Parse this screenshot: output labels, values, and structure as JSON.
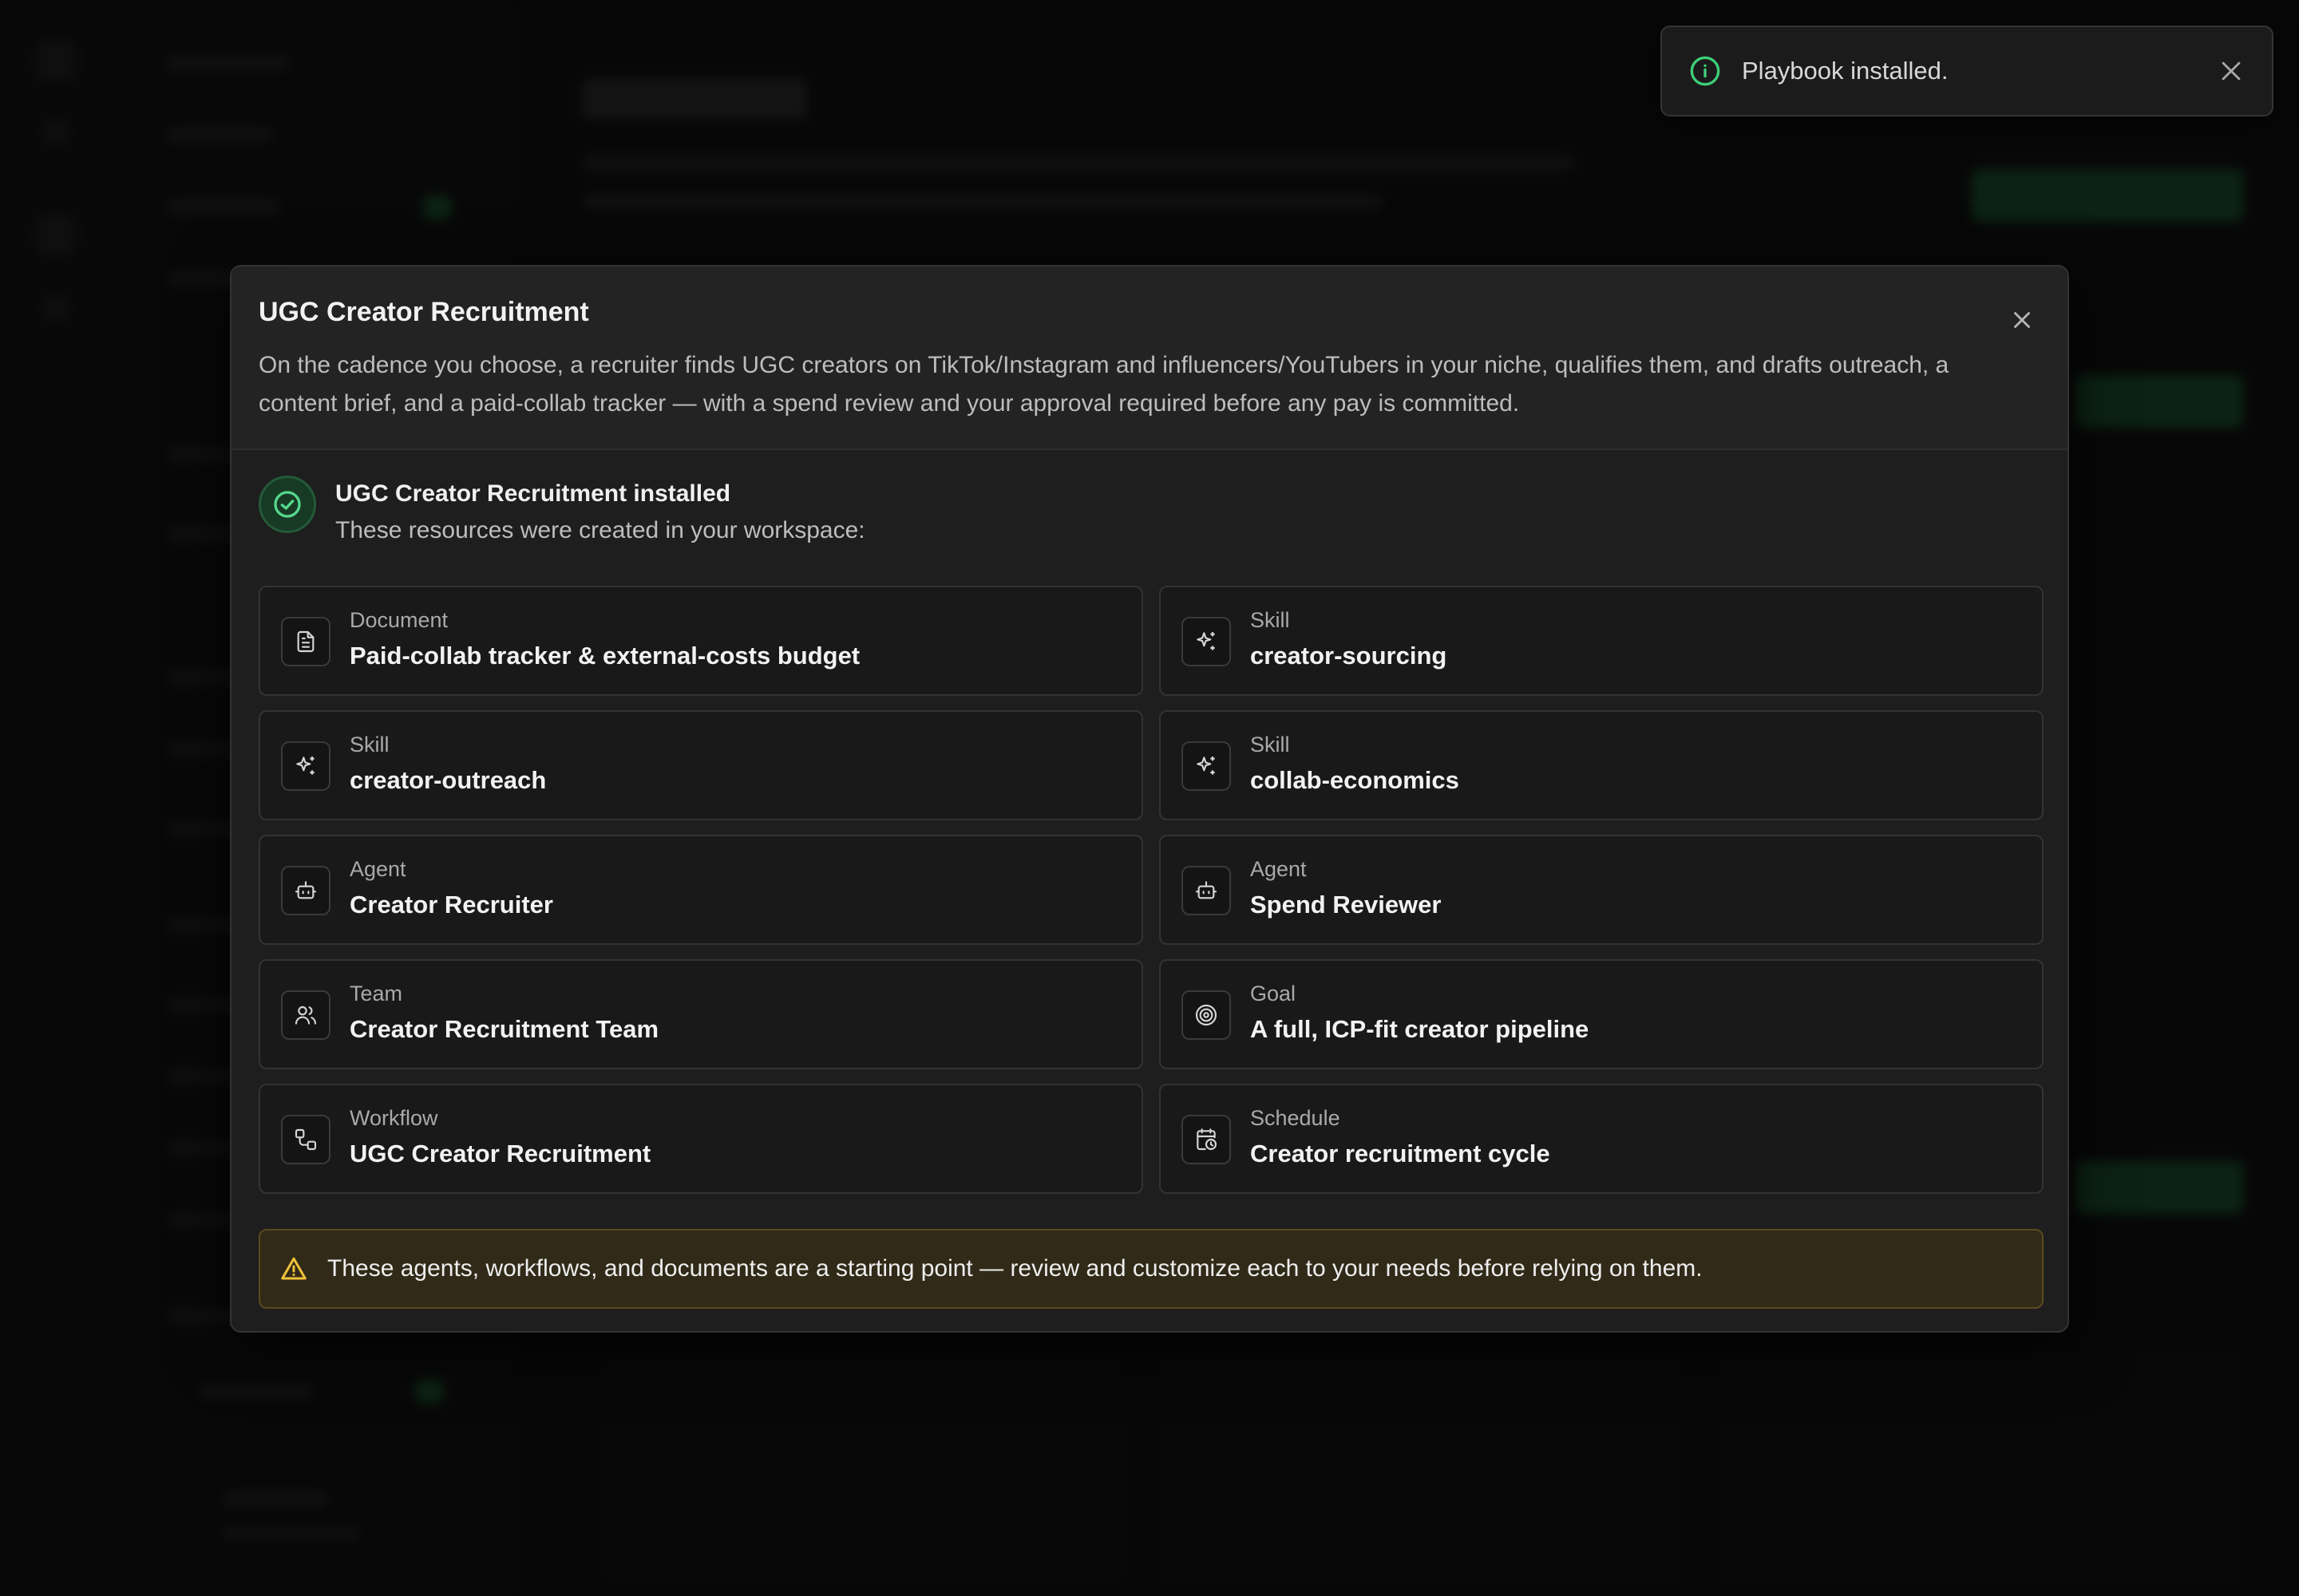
{
  "toast": {
    "icon": "info-icon",
    "message": "Playbook installed.",
    "close_icon": "close-icon"
  },
  "modal": {
    "title": "UGC Creator Recruitment",
    "description": "On the cadence you choose, a recruiter finds UGC creators on TikTok/Instagram and influencers/YouTubers in your niche, qualifies them, and drafts outreach, a content brief, and a paid-collab tracker — with a spend review and your approval required before any pay is committed.",
    "close_icon": "close-icon",
    "installed": {
      "icon": "check-circle-icon",
      "title": "UGC Creator Recruitment installed",
      "subtitle": "These resources were created in your workspace:"
    },
    "resources": [
      {
        "type": "Document",
        "name": "Paid-collab tracker & external-costs budget",
        "icon": "document-icon"
      },
      {
        "type": "Skill",
        "name": "creator-sourcing",
        "icon": "sparkles-icon"
      },
      {
        "type": "Skill",
        "name": "creator-outreach",
        "icon": "sparkles-icon"
      },
      {
        "type": "Skill",
        "name": "collab-economics",
        "icon": "sparkles-icon"
      },
      {
        "type": "Agent",
        "name": "Creator Recruiter",
        "icon": "bot-icon"
      },
      {
        "type": "Agent",
        "name": "Spend Reviewer",
        "icon": "bot-icon"
      },
      {
        "type": "Team",
        "name": "Creator Recruitment Team",
        "icon": "users-icon"
      },
      {
        "type": "Goal",
        "name": "A full, ICP-fit creator pipeline",
        "icon": "target-icon"
      },
      {
        "type": "Workflow",
        "name": "UGC Creator Recruitment",
        "icon": "workflow-icon"
      },
      {
        "type": "Schedule",
        "name": "Creator recruitment cycle",
        "icon": "calendar-clock-icon"
      }
    ],
    "warning": {
      "icon": "warning-icon",
      "text": "These agents, workflows, and documents are a starting point — review and customize each to your needs before relying on them."
    }
  },
  "colors": {
    "accent_green": "#3ecf78",
    "warning_yellow": "#f0c23a",
    "modal_bg": "#1e1e1e",
    "card_bg": "#191919"
  }
}
